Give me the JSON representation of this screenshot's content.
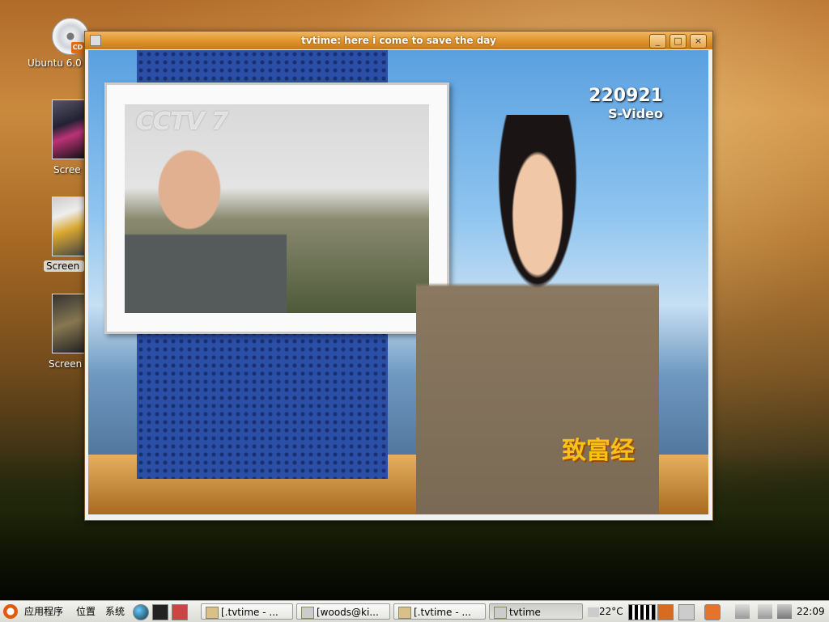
{
  "desktop": {
    "icons": [
      {
        "label": "Ubuntu 6.0"
      },
      {
        "label": "Scree"
      },
      {
        "label": "Screen"
      },
      {
        "label": "Screen"
      }
    ]
  },
  "window": {
    "title": "tvtime: here i come to save the day"
  },
  "video": {
    "inset_logo": "CCTV 7",
    "channel_number": "220921",
    "input": "S-Video",
    "show_logo": "致富经"
  },
  "taskbar": {
    "menus": [
      "应用程序",
      "位置",
      "系统"
    ],
    "tasks": [
      "[.tvtime - ...",
      "[woods@ki...",
      "[.tvtime - ...",
      "tvtime"
    ],
    "temperature": "22°C",
    "clock": "22:09"
  }
}
